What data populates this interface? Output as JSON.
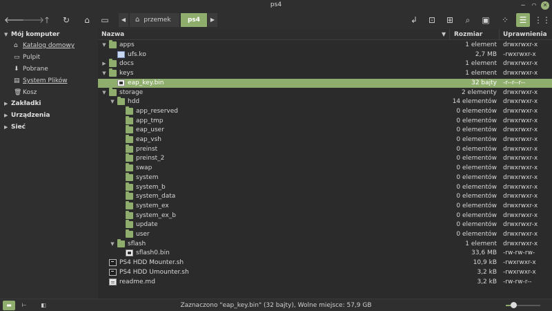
{
  "window": {
    "title": "ps4"
  },
  "toolbar": {
    "path": [
      {
        "label": "przemek",
        "icon": "home-icon"
      },
      {
        "label": "ps4"
      }
    ]
  },
  "sidebar": {
    "sections": [
      {
        "label": "Mój komputer",
        "expanded": true,
        "items": [
          {
            "label": "Katalog domowy",
            "icon": "home-icon"
          },
          {
            "label": "Pulpit",
            "icon": "desktop-icon"
          },
          {
            "label": "Pobrane",
            "icon": "download-icon"
          },
          {
            "label": "System Plików",
            "icon": "drive-icon"
          },
          {
            "label": "Kosz",
            "icon": "trash-icon"
          }
        ]
      },
      {
        "label": "Zakładki",
        "expanded": false
      },
      {
        "label": "Urządzenia",
        "expanded": false
      },
      {
        "label": "Sieć",
        "expanded": false
      }
    ]
  },
  "columns": {
    "name": "Nazwa",
    "size": "Rozmiar",
    "perms": "Uprawnienia"
  },
  "rows": [
    {
      "name": "apps",
      "type": "folder",
      "depth": 0,
      "expander": "open",
      "size": "1 element",
      "perms": "drwxrwxr-x"
    },
    {
      "name": "ufs.ko",
      "type": "ko",
      "depth": 1,
      "expander": "",
      "size": "2,7 MB",
      "perms": "-rwxrwxr-x"
    },
    {
      "name": "docs",
      "type": "folder",
      "depth": 0,
      "expander": "closed",
      "size": "1 element",
      "perms": "drwxrwxr-x"
    },
    {
      "name": "keys",
      "type": "folder",
      "depth": 0,
      "expander": "open",
      "size": "1 element",
      "perms": "drwxrwxr-x"
    },
    {
      "name": "eap_key.bin",
      "type": "bin",
      "depth": 1,
      "expander": "",
      "size": "32 bajty",
      "perms": "-r--r--r--",
      "selected": true
    },
    {
      "name": "storage",
      "type": "folder",
      "depth": 0,
      "expander": "open",
      "size": "2 elementy",
      "perms": "drwxrwxr-x"
    },
    {
      "name": "hdd",
      "type": "folder",
      "depth": 1,
      "expander": "open",
      "size": "14 elementów",
      "perms": "drwxrwxr-x"
    },
    {
      "name": "app_reserved",
      "type": "folder",
      "depth": 2,
      "expander": "",
      "size": "0 elementów",
      "perms": "drwxrwxr-x"
    },
    {
      "name": "app_tmp",
      "type": "folder",
      "depth": 2,
      "expander": "",
      "size": "0 elementów",
      "perms": "drwxrwxr-x"
    },
    {
      "name": "eap_user",
      "type": "folder",
      "depth": 2,
      "expander": "",
      "size": "0 elementów",
      "perms": "drwxrwxr-x"
    },
    {
      "name": "eap_vsh",
      "type": "folder",
      "depth": 2,
      "expander": "",
      "size": "0 elementów",
      "perms": "drwxrwxr-x"
    },
    {
      "name": "preinst",
      "type": "folder",
      "depth": 2,
      "expander": "",
      "size": "0 elementów",
      "perms": "drwxrwxr-x"
    },
    {
      "name": "preinst_2",
      "type": "folder",
      "depth": 2,
      "expander": "",
      "size": "0 elementów",
      "perms": "drwxrwxr-x"
    },
    {
      "name": "swap",
      "type": "folder",
      "depth": 2,
      "expander": "",
      "size": "0 elementów",
      "perms": "drwxrwxr-x"
    },
    {
      "name": "system",
      "type": "folder",
      "depth": 2,
      "expander": "",
      "size": "0 elementów",
      "perms": "drwxrwxr-x"
    },
    {
      "name": "system_b",
      "type": "folder",
      "depth": 2,
      "expander": "",
      "size": "0 elementów",
      "perms": "drwxrwxr-x"
    },
    {
      "name": "system_data",
      "type": "folder",
      "depth": 2,
      "expander": "",
      "size": "0 elementów",
      "perms": "drwxrwxr-x"
    },
    {
      "name": "system_ex",
      "type": "folder",
      "depth": 2,
      "expander": "",
      "size": "0 elementów",
      "perms": "drwxrwxr-x"
    },
    {
      "name": "system_ex_b",
      "type": "folder",
      "depth": 2,
      "expander": "",
      "size": "0 elementów",
      "perms": "drwxrwxr-x"
    },
    {
      "name": "update",
      "type": "folder",
      "depth": 2,
      "expander": "",
      "size": "0 elementów",
      "perms": "drwxrwxr-x"
    },
    {
      "name": "user",
      "type": "folder",
      "depth": 2,
      "expander": "",
      "size": "0 elementów",
      "perms": "drwxrwxr-x"
    },
    {
      "name": "sflash",
      "type": "folder",
      "depth": 1,
      "expander": "open",
      "size": "1 element",
      "perms": "drwxrwxr-x"
    },
    {
      "name": "sflash0.bin",
      "type": "bin",
      "depth": 2,
      "expander": "",
      "size": "33,6 MB",
      "perms": "-rw-rw-rw-"
    },
    {
      "name": "PS4 HDD Mounter.sh",
      "type": "sh",
      "depth": 0,
      "expander": "",
      "size": "10,9 kB",
      "perms": "-rwxrwxr-x"
    },
    {
      "name": "PS4 HDD Umounter.sh",
      "type": "sh",
      "depth": 0,
      "expander": "",
      "size": "3,2 kB",
      "perms": "-rwxrwxr-x"
    },
    {
      "name": "readme.md",
      "type": "md",
      "depth": 0,
      "expander": "",
      "size": "3,2 kB",
      "perms": "-rw-rw-r--"
    }
  ],
  "statusbar": {
    "text": "Zaznaczono \"eap_key.bin\" (32 bajty), Wolne miejsce: 57,9 GB",
    "zoom_fraction": 0.22
  },
  "colors": {
    "accent": "#8fad6d",
    "background": "#2b2b2b",
    "panel": "#2f2f2f"
  }
}
